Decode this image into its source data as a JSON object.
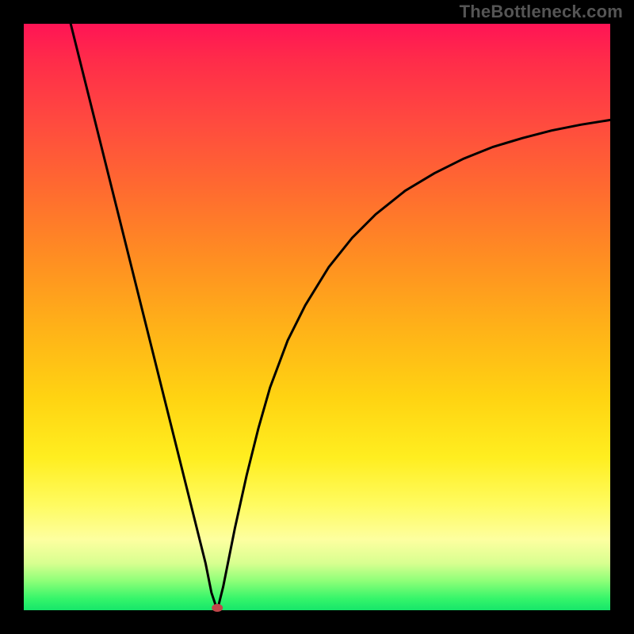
{
  "watermark": "TheBottleneck.com",
  "chart_data": {
    "type": "line",
    "title": "",
    "xlabel": "",
    "ylabel": "",
    "xlim": [
      0,
      100
    ],
    "ylim": [
      0,
      100
    ],
    "grid": false,
    "legend": false,
    "annotations": [],
    "min_point": {
      "x": 33,
      "y": 0
    },
    "series": [
      {
        "name": "left-branch",
        "x": [
          8,
          10,
          12,
          14,
          16,
          18,
          20,
          22,
          24,
          26,
          28,
          30,
          31,
          32,
          33
        ],
        "y": [
          100,
          92,
          84,
          76,
          68,
          60,
          52,
          44,
          36,
          28,
          20,
          12,
          8,
          3,
          0
        ]
      },
      {
        "name": "right-branch",
        "x": [
          33,
          34,
          35,
          36,
          38,
          40,
          42,
          45,
          48,
          52,
          56,
          60,
          65,
          70,
          75,
          80,
          85,
          90,
          95,
          100
        ],
        "y": [
          0,
          4,
          9,
          14,
          23,
          31,
          38,
          46,
          52,
          58.5,
          63.5,
          67.5,
          71.5,
          74.5,
          77,
          79,
          80.5,
          81.8,
          82.8,
          83.6
        ]
      }
    ]
  },
  "colors": {
    "background": "#000000",
    "curve": "#000000",
    "marker": "#c1464a",
    "gradient_top": "#ff1455",
    "gradient_bottom": "#16e66a"
  }
}
